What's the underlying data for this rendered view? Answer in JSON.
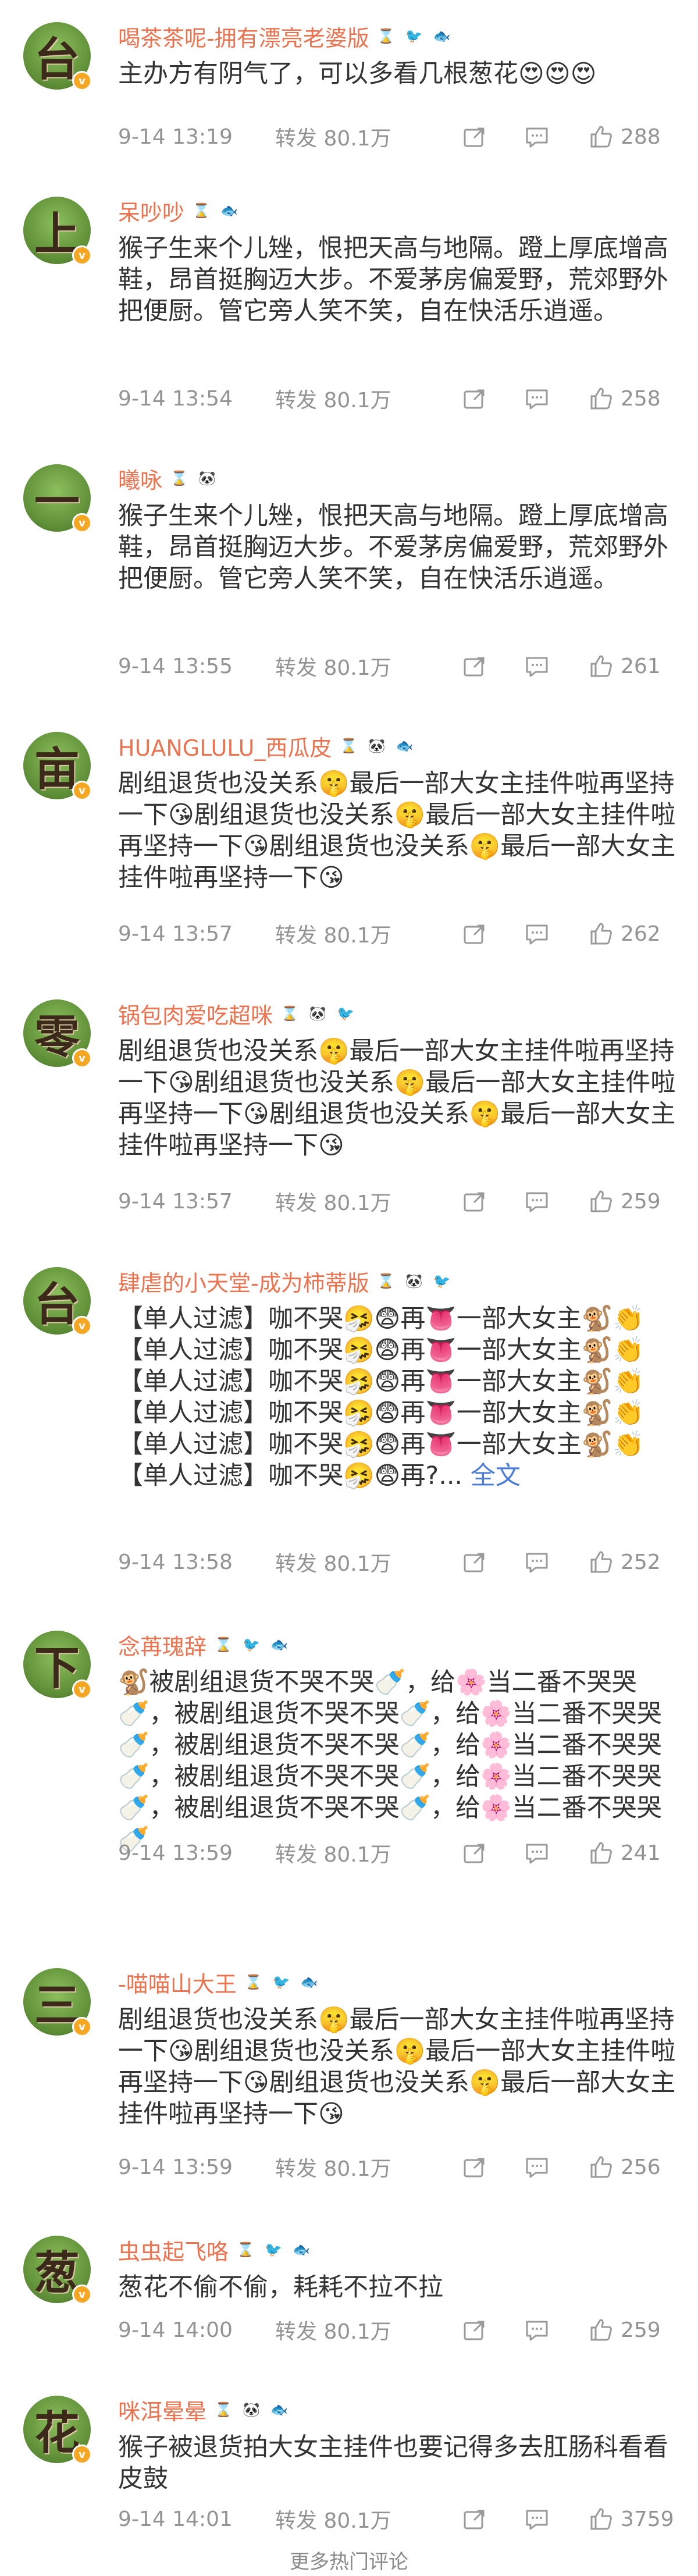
{
  "comments": [
    {
      "avatar_char": "台",
      "name": "喝茶茶呢-拥有漂亮老婆版",
      "badges": [
        "hourglass",
        "bird",
        "fish"
      ],
      "content": "主办方有阴气了，可以多看几根葱花😍😍😍",
      "more": "",
      "time": "9-14 13:19",
      "repost": "转发 80.1万",
      "likes": "288"
    },
    {
      "avatar_char": "上",
      "name": "呆吵吵",
      "badges": [
        "hourglass",
        "fish"
      ],
      "content": "猴子生来个儿矬，恨把天高与地隔。蹬上厚底增高鞋，昂首挺胸迈大步。不爱茅房偏爱野，荒郊野外把便厨。管它旁人笑不笑，自在快活乐逍遥。",
      "more": "",
      "time": "9-14 13:54",
      "repost": "转发 80.1万",
      "likes": "258"
    },
    {
      "avatar_char": "一",
      "name": "曦咏",
      "badges": [
        "hourglass",
        "panda"
      ],
      "content": "猴子生来个儿矬，恨把天高与地隔。蹬上厚底增高鞋，昂首挺胸迈大步。不爱茅房偏爱野，荒郊野外把便厨。管它旁人笑不笑，自在快活乐逍遥。",
      "more": "",
      "time": "9-14 13:55",
      "repost": "转发 80.1万",
      "likes": "261"
    },
    {
      "avatar_char": "亩",
      "name": "HUANGLULU_西瓜皮",
      "badges": [
        "hourglass",
        "panda",
        "fish"
      ],
      "content": "剧组退货也没关系🤫最后一部大女主挂件啦再坚持一下😘剧组退货也没关系🤫最后一部大女主挂件啦再坚持一下😘剧组退货也没关系🤫最后一部大女主挂件啦再坚持一下😘",
      "more": "",
      "time": "9-14 13:57",
      "repost": "转发 80.1万",
      "likes": "262"
    },
    {
      "avatar_char": "零",
      "name": "锅包肉爱吃超咪",
      "badges": [
        "hourglass",
        "panda",
        "bird"
      ],
      "content": "剧组退货也没关系🤫最后一部大女主挂件啦再坚持一下😘剧组退货也没关系🤫最后一部大女主挂件啦再坚持一下😘剧组退货也没关系🤫最后一部大女主挂件啦再坚持一下😘",
      "more": "",
      "time": "9-14 13:57",
      "repost": "转发 80.1万",
      "likes": "259"
    },
    {
      "avatar_char": "台",
      "name": "肆虐的小天堂-成为柿蒂版",
      "badges": [
        "hourglass",
        "panda",
        "bird"
      ],
      "content": "【单人过滤】咖不哭🤧😨再👅一部大女主🐒👏【单人过滤】咖不哭🤧😨再👅一部大女主🐒👏【单人过滤】咖不哭🤧😨再👅一部大女主🐒👏【单人过滤】咖不哭🤧😨再👅一部大女主🐒👏【单人过滤】咖不哭🤧😨再👅一部大女主🐒👏【单人过滤】咖不哭🤧😨再?...",
      "more": " 全文",
      "time": "9-14 13:58",
      "repost": "转发 80.1万",
      "likes": "252"
    },
    {
      "avatar_char": "下",
      "name": "念苒瑰辞",
      "badges": [
        "hourglass",
        "bird",
        "fish"
      ],
      "content": "🐒被剧组退货不哭不哭🍼，给🌸当二番不哭哭🍼，被剧组退货不哭不哭🍼，给🌸当二番不哭哭🍼，被剧组退货不哭不哭🍼，给🌸当二番不哭哭🍼，被剧组退货不哭不哭🍼，给🌸当二番不哭哭🍼，被剧组退货不哭不哭🍼，给🌸当二番不哭哭🍼",
      "more": "",
      "time": "9-14 13:59",
      "repost": "转发 80.1万",
      "likes": "241"
    },
    {
      "avatar_char": "三",
      "name": "-喵喵山大王",
      "badges": [
        "hourglass",
        "bird",
        "fish"
      ],
      "content": "剧组退货也没关系🤫最后一部大女主挂件啦再坚持一下😘剧组退货也没关系🤫最后一部大女主挂件啦再坚持一下😘剧组退货也没关系🤫最后一部大女主挂件啦再坚持一下😘",
      "more": "",
      "time": "9-14 13:59",
      "repost": "转发 80.1万",
      "likes": "256"
    },
    {
      "avatar_char": "葱",
      "name": "虫虫起飞咯",
      "badges": [
        "hourglass",
        "bird",
        "fish"
      ],
      "content": "葱花不偷不偷，耗耗不拉不拉",
      "more": "",
      "time": "9-14 14:00",
      "repost": "转发 80.1万",
      "likes": "259"
    },
    {
      "avatar_char": "花",
      "name": "咪洱晕晕",
      "badges": [
        "hourglass",
        "panda",
        "fish"
      ],
      "content": "猴子被退货拍大女主挂件也要记得多去肛肠科看看皮鼓",
      "more": "",
      "time": "9-14 14:01",
      "repost": "转发 80.1万",
      "likes": "3759"
    }
  ],
  "footer_hint": "更多热门评论",
  "badge_icons": {
    "hourglass": "⌛",
    "panda": "🐼",
    "bird": "🐦",
    "fish": "🐟"
  },
  "verified_mark": "v",
  "colors": {
    "name": "#eb7350",
    "text": "#333333",
    "meta": "#939393",
    "link": "#4a7bd6"
  }
}
